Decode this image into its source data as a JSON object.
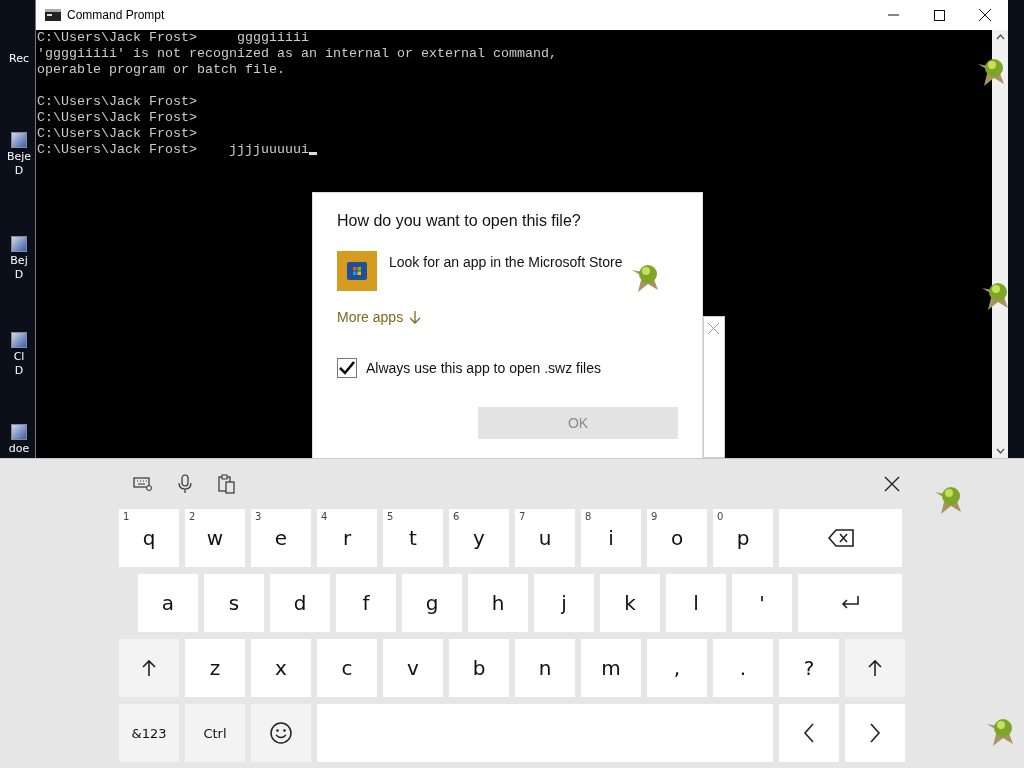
{
  "desktop_icons": [
    {
      "lines": [
        "Rec"
      ],
      "has_icon": false
    },
    {
      "lines": [
        "Beje",
        "D"
      ],
      "has_icon": true
    },
    {
      "lines": [
        "Bej",
        "D"
      ],
      "has_icon": true
    },
    {
      "lines": [
        "Cl",
        "D"
      ],
      "has_icon": true
    },
    {
      "lines": [
        "doe"
      ],
      "has_icon": true
    }
  ],
  "window": {
    "title": "Command Prompt"
  },
  "console": {
    "blocks": [
      [
        "C:\\Users\\Jack Frost>     ggggiiiii",
        "'ggggiiiii' is not recognized as an internal or external command,",
        "operable program or batch file."
      ],
      [
        "C:\\Users\\Jack Frost>",
        "C:\\Users\\Jack Frost>",
        "C:\\Users\\Jack Frost>",
        "C:\\Users\\Jack Frost>    jjjjuuuuui"
      ]
    ],
    "cursor": true
  },
  "dialog": {
    "title": "How do you want to open this file?",
    "option": "Look for an app in the Microsoft Store",
    "more_link": "More apps",
    "checkbox": {
      "label": "Always use this app to open .swz files",
      "checked": true
    },
    "ok_button": {
      "label": "OK",
      "disabled": true
    }
  },
  "keyboard": {
    "rows": [
      [
        {
          "kind": "char",
          "label": "q",
          "hint": "1"
        },
        {
          "kind": "char",
          "label": "w",
          "hint": "2"
        },
        {
          "kind": "char",
          "label": "e",
          "hint": "3"
        },
        {
          "kind": "char",
          "label": "r",
          "hint": "4"
        },
        {
          "kind": "char",
          "label": "t",
          "hint": "5"
        },
        {
          "kind": "char",
          "label": "y",
          "hint": "6"
        },
        {
          "kind": "char",
          "label": "u",
          "hint": "7"
        },
        {
          "kind": "char",
          "label": "i",
          "hint": "8"
        },
        {
          "kind": "char",
          "label": "o",
          "hint": "9"
        },
        {
          "kind": "char",
          "label": "p",
          "hint": "0"
        },
        {
          "kind": "backspace"
        }
      ],
      [
        {
          "kind": "char",
          "label": "a"
        },
        {
          "kind": "char",
          "label": "s"
        },
        {
          "kind": "char",
          "label": "d"
        },
        {
          "kind": "char",
          "label": "f"
        },
        {
          "kind": "char",
          "label": "g"
        },
        {
          "kind": "char",
          "label": "h"
        },
        {
          "kind": "char",
          "label": "j"
        },
        {
          "kind": "char",
          "label": "k"
        },
        {
          "kind": "char",
          "label": "l"
        },
        {
          "kind": "char",
          "label": "'"
        },
        {
          "kind": "enter"
        }
      ],
      [
        {
          "kind": "shift"
        },
        {
          "kind": "char",
          "label": "z"
        },
        {
          "kind": "char",
          "label": "x"
        },
        {
          "kind": "char",
          "label": "c"
        },
        {
          "kind": "char",
          "label": "v"
        },
        {
          "kind": "char",
          "label": "b"
        },
        {
          "kind": "char",
          "label": "n"
        },
        {
          "kind": "char",
          "label": "m"
        },
        {
          "kind": "char",
          "label": ","
        },
        {
          "kind": "char",
          "label": "."
        },
        {
          "kind": "char",
          "label": "?"
        },
        {
          "kind": "shift"
        }
      ],
      [
        {
          "kind": "mode",
          "label": "&123"
        },
        {
          "kind": "mode",
          "label": "Ctrl"
        },
        {
          "kind": "emoji"
        },
        {
          "kind": "space"
        },
        {
          "kind": "left"
        },
        {
          "kind": "right"
        }
      ]
    ]
  }
}
